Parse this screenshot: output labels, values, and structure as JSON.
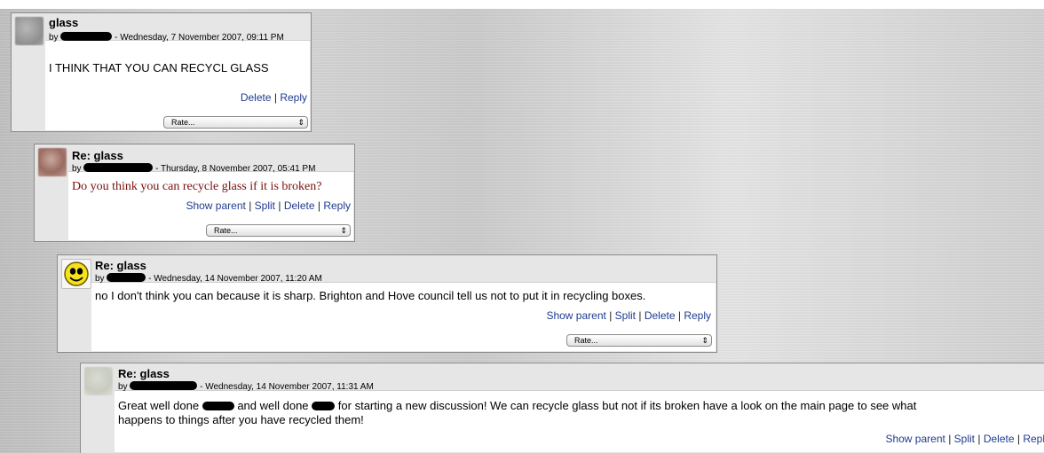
{
  "posts": [
    {
      "title": "glass",
      "by": "by",
      "date": "- Wednesday, 7 November 2007, 09:11 PM",
      "message": "I THINK THAT YOU CAN   RECYCL GLASS",
      "links": {
        "delete": "Delete",
        "reply": "Reply"
      },
      "rate_label": "Rate..."
    },
    {
      "title": "Re: glass",
      "by": "by",
      "date": "- Thursday, 8 November 2007, 05:41 PM",
      "message": "Do you think you can recycle glass if it is broken?",
      "links": {
        "show_parent": "Show parent",
        "split": "Split",
        "delete": "Delete",
        "reply": "Reply"
      },
      "rate_label": "Rate..."
    },
    {
      "title": "Re: glass",
      "by": "by",
      "date": "- Wednesday, 14 November 2007, 11:20 AM",
      "message": "no I don't think you can because it is sharp. Brighton and Hove council tell us not to put it in recycling boxes.",
      "links": {
        "show_parent": "Show parent",
        "split": "Split",
        "delete": "Delete",
        "reply": "Reply"
      },
      "rate_label": "Rate..."
    },
    {
      "title": "Re: glass",
      "by": "by",
      "date": "- Wednesday, 14 November 2007, 11:31 AM",
      "message_parts": [
        "Great well done",
        "and well done",
        "for starting a new discussion! We can recycle glass but not if its broken have a look on the main page to see what"
      ],
      "message_line2": "happens to things after you have recycled them!",
      "links": {
        "show_parent": "Show parent",
        "split": "Split",
        "delete": "Delete",
        "reply": "Repl"
      }
    }
  ],
  "separator": "|",
  "icons": {
    "select_arrows": "⇕",
    "avatar_smiley": "smiley-face-icon"
  }
}
